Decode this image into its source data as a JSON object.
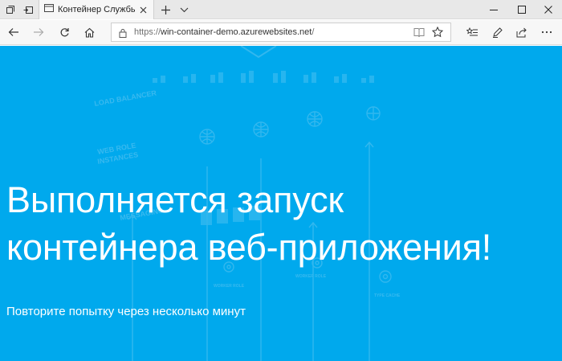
{
  "browser": {
    "tab": {
      "title": "Контейнер Службы п"
    },
    "address": {
      "scheme": "https://",
      "host": "win-container-demo.azurewebsites.net",
      "path": "/"
    },
    "icons": {
      "tab_preview": "tab-preview-icon",
      "set_aside": "set-aside-tabs-icon",
      "page": "page-icon",
      "close_tab": "close-icon",
      "new_tab": "plus-icon",
      "tab_list": "chevron-down-icon",
      "minimize": "minimize-icon",
      "maximize": "maximize-icon",
      "close_window": "close-icon",
      "back": "back-arrow-icon",
      "forward": "forward-arrow-icon",
      "refresh": "refresh-icon",
      "home": "home-icon",
      "lock": "lock-icon",
      "reading_view": "reading-view-icon",
      "favorite": "star-icon",
      "favorites_hub": "favorites-hub-icon",
      "notes": "pen-icon",
      "share": "share-icon",
      "more": "more-icon"
    }
  },
  "page": {
    "headline_line1": "Выполняется запуск",
    "headline_line2": "контейнера веб-приложения!",
    "subline": "Повторите попытку через несколько минут",
    "background_labels": [
      "LOAD BALANCER",
      "WEB ROLE",
      "INSTANCES",
      "MESSAGING",
      "WORKER ROLE",
      "WORKER ROLE",
      "TYPE CACHE"
    ],
    "colors": {
      "background": "#00a9ed",
      "text": "#ffffff",
      "watermark": "#5cc8f2"
    }
  }
}
